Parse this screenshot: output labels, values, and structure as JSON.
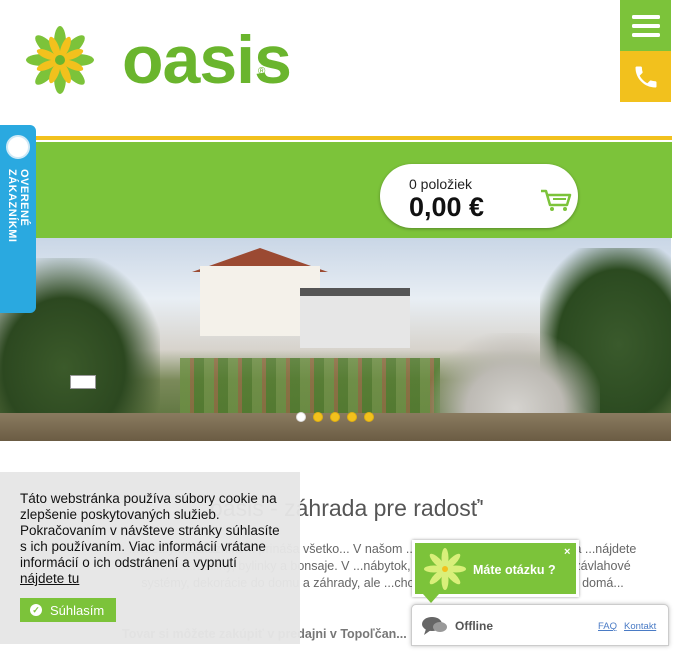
{
  "header": {
    "logo_text": "oasis",
    "logo_reg": "®",
    "menu_icon": "hamburger-icon",
    "phone_icon": "phone-icon"
  },
  "colors": {
    "brand_green": "#7cc33a",
    "brand_yellow": "#f2c11d",
    "verified_blue": "#2aa9e0"
  },
  "cart": {
    "count": "0 položiek",
    "total": "0,00 €",
    "icon": "cart-icon"
  },
  "verified_badge": {
    "label": "OVERENÉ ZÁKAZNÍKMI"
  },
  "banner": {
    "slides": 5,
    "active_slide": 1
  },
  "main": {
    "headline": "oasis - záhrada pre radosť'",
    "paragraph": "...všetkým zákazníkom prináša všetko... V našom ...potrebné pre záhradkárov. Na ...nájdete okrasné ...rastliny, bylinky a bonsaje. V ...nábytok, ...údržbu trávnika a záhrady, závlahové systémy, dekorácie do domu a záhrady, ale ...chovateľské potreby a krmivá pre domá...",
    "bold_line": "Tovar si môžete zakúpiť v predajni v Topoľčan..."
  },
  "cookie": {
    "text": "Táto webstránka používa súbory cookie na zlepšenie poskytovaných služieb. Pokračovaním v návšteve stránky súhlasíte s ich používaním. Viac informácií vrátane informácií o ich odstránení a vypnutí",
    "link": "nájdete tu",
    "button": "Súhlasím"
  },
  "chat": {
    "question": "Máte otázku ?",
    "close": "×",
    "status": "Offline",
    "faq": "FAQ",
    "contact": "Kontakt"
  }
}
